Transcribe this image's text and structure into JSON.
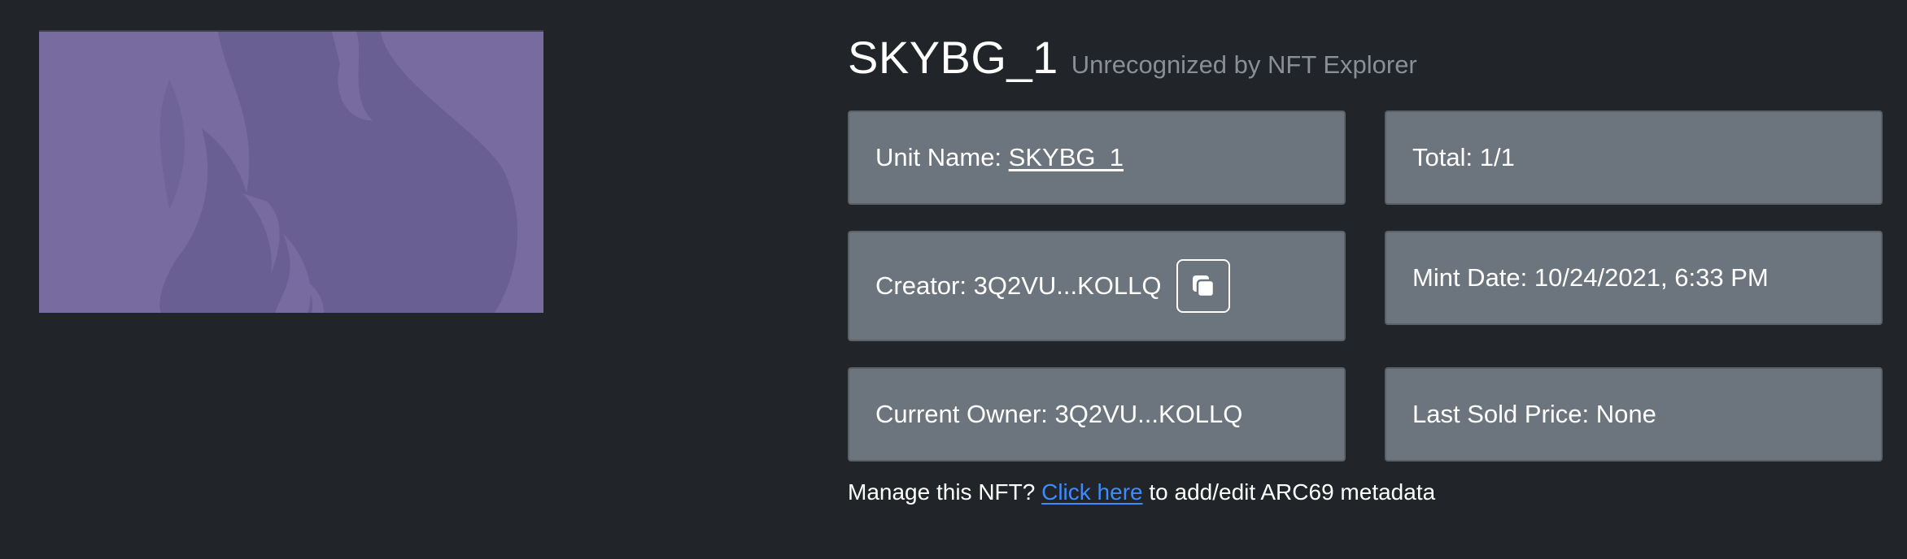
{
  "nft": {
    "title": "SKYBG_1",
    "subtitle": "Unrecognized by NFT Explorer",
    "image_color": "#776ba0",
    "image_flame_color": "#6a5f92"
  },
  "cards": {
    "unit_name": {
      "label": "Unit Name: ",
      "value": "SKYBG_1"
    },
    "total": {
      "label": "Total: ",
      "value": "1/1"
    },
    "creator": {
      "label": "Creator: ",
      "value": "3Q2VU...KOLLQ",
      "copy_icon": "copy-icon"
    },
    "mint_date": {
      "label": "Mint Date: ",
      "value": "10/24/2021, 6:33 PM"
    },
    "current_owner": {
      "label": "Current Owner: ",
      "value": "3Q2VU...KOLLQ"
    },
    "last_sold_price": {
      "label": "Last Sold Price: ",
      "value": "None"
    }
  },
  "manage": {
    "prefix": "Manage this NFT? ",
    "link_text": "Click here",
    "suffix": " to add/edit ARC69 metadata"
  },
  "colors": {
    "background": "#212429",
    "card": "#6c757d",
    "link": "#3d8bfd",
    "subtitle": "#8a8f96"
  }
}
